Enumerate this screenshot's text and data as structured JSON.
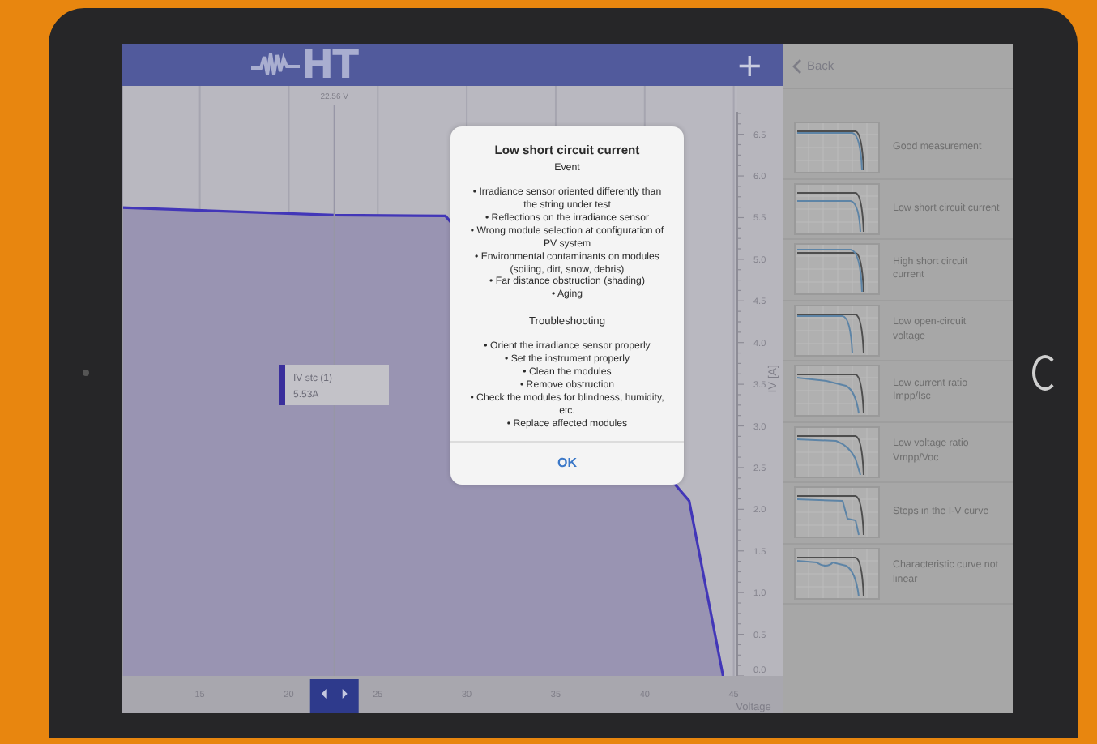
{
  "header": {
    "logo": "HT",
    "add_button": "+"
  },
  "chart": {
    "tooltip": {
      "value": "5.53A"
    },
    "chart_data": {
      "type": "area",
      "xlabel": "Voltage",
      "ylabel": "IV [A]",
      "grid": true,
      "ref_lines": [
        {
          "axis": "x",
          "value": 22.56,
          "label": "22.56 V"
        }
      ],
      "x": [
        10.6,
        22.56,
        28.8,
        42.5,
        44.4
      ],
      "series": [
        {
          "name": "IV stc (1)",
          "color": "#4236b8",
          "values": [
            5.62,
            5.53,
            5.52,
            2.1,
            0
          ]
        }
      ],
      "xlim": [
        10.6,
        45.2
      ],
      "ylim": [
        0,
        7.08
      ],
      "xticks": [
        15,
        20,
        25,
        30,
        35,
        40,
        45
      ],
      "yticks": [
        {
          "value": 0,
          "label": "0.0"
        },
        {
          "value": 0.5,
          "label": "0.5"
        },
        {
          "value": 1,
          "label": "1.0"
        },
        {
          "value": 1.5,
          "label": "1.5"
        },
        {
          "value": 2,
          "label": "2.0"
        },
        {
          "value": 2.5,
          "label": "2.5"
        },
        {
          "value": 3,
          "label": "3.0"
        },
        {
          "value": 3.5,
          "label": "3.5"
        },
        {
          "value": 4,
          "label": "4.0"
        },
        {
          "value": 4.5,
          "label": "4.5"
        },
        {
          "value": 5,
          "label": "5.0"
        },
        {
          "value": 5.5,
          "label": "5.5"
        },
        {
          "value": 6,
          "label": "6.0"
        },
        {
          "value": 6.5,
          "label": "6.5"
        }
      ]
    }
  },
  "sidebar": {
    "back": "Back",
    "items": [
      {
        "label": "Good measurement",
        "kind": "good"
      },
      {
        "label": "Low short circuit current",
        "kind": "low-isc"
      },
      {
        "label": "High short circuit current",
        "kind": "high-isc"
      },
      {
        "label": "Low open-circuit voltage",
        "kind": "low-voc"
      },
      {
        "label": "Low current ratio Impp/Isc",
        "kind": "low-iratio"
      },
      {
        "label": "Low voltage ratio Vmpp/Voc",
        "kind": "low-vratio"
      },
      {
        "label": "Steps in the I-V curve",
        "kind": "steps"
      },
      {
        "label": "Characteristic curve not linear",
        "kind": "nonlinear"
      }
    ]
  },
  "dialog": {
    "title": "Low short circuit current",
    "event_heading": "Event",
    "event_items": [
      "• Irradiance sensor oriented differently than the string under test",
      "• Reflections on the irradiance sensor",
      "• Wrong module selection at configuration of PV system",
      "• Environmental contaminants on modules (soiling, dirt, snow, debris)",
      "• Far distance obstruction (shading)",
      "• Aging"
    ],
    "troubleshooting_heading": "Troubleshooting",
    "troubleshooting_items": [
      "• Orient the irradiance sensor properly",
      "• Set the instrument properly",
      "• Clean the modules",
      "• Remove obstruction",
      "• Check the modules for blindness, humidity, etc.",
      "• Replace affected modules"
    ],
    "ok_button": "OK"
  }
}
